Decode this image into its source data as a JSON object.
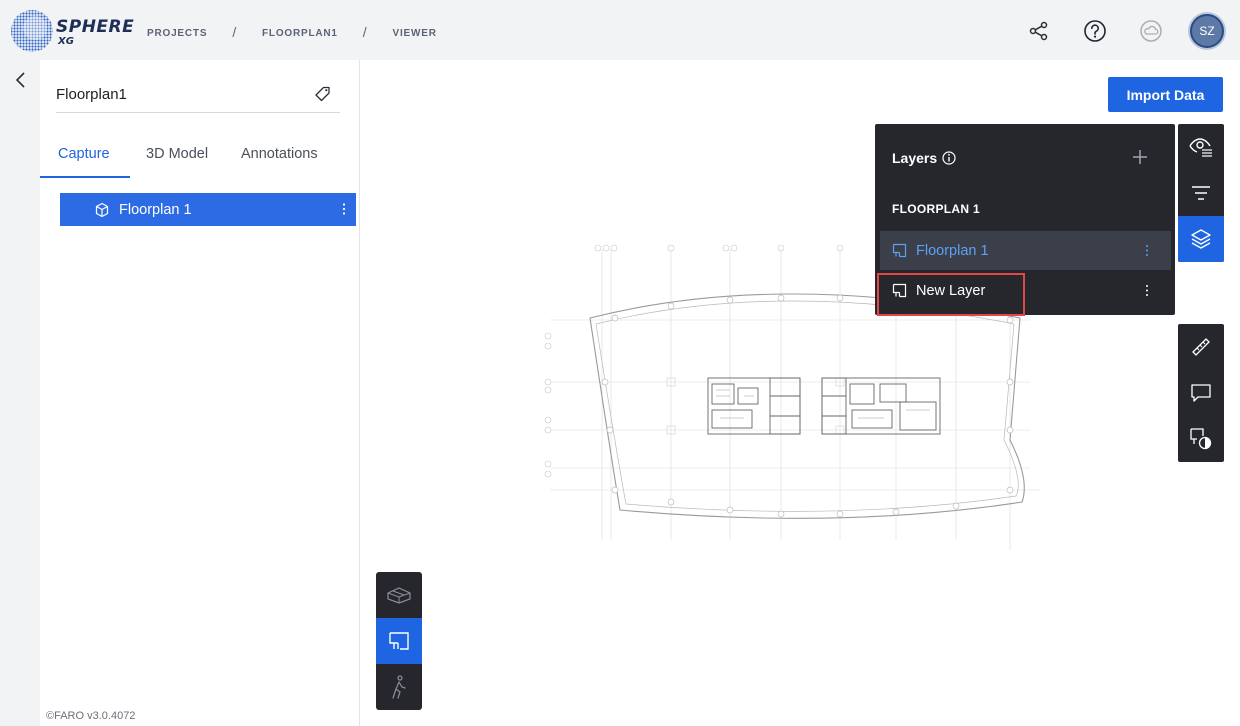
{
  "app": {
    "logo_text": "SPHERE",
    "logo_sub": "XG"
  },
  "breadcrumb": [
    "PROJECTS",
    "FLOORPLAN1",
    "VIEWER"
  ],
  "breadcrumb_separator": "/",
  "user": {
    "initials": "SZ"
  },
  "sidebar": {
    "project_title": "Floorplan1",
    "tabs": [
      {
        "label": "Capture",
        "active": true
      },
      {
        "label": "3D Model",
        "active": false
      },
      {
        "label": "Annotations",
        "active": false
      }
    ],
    "items": [
      {
        "label": "Floorplan 1",
        "selected": true
      }
    ],
    "version": "©FARO v3.0.4072"
  },
  "viewer": {
    "import_label": "Import Data",
    "layers_panel": {
      "title": "Layers",
      "group": "FLOORPLAN 1",
      "layers": [
        {
          "label": "Floorplan 1",
          "selected": true
        },
        {
          "label": "New Layer",
          "selected": false
        }
      ]
    }
  },
  "colors": {
    "accent": "#1f64e0",
    "panel_dark": "#25272c",
    "highlight": "#e04747",
    "brand": "#1e2e57"
  }
}
